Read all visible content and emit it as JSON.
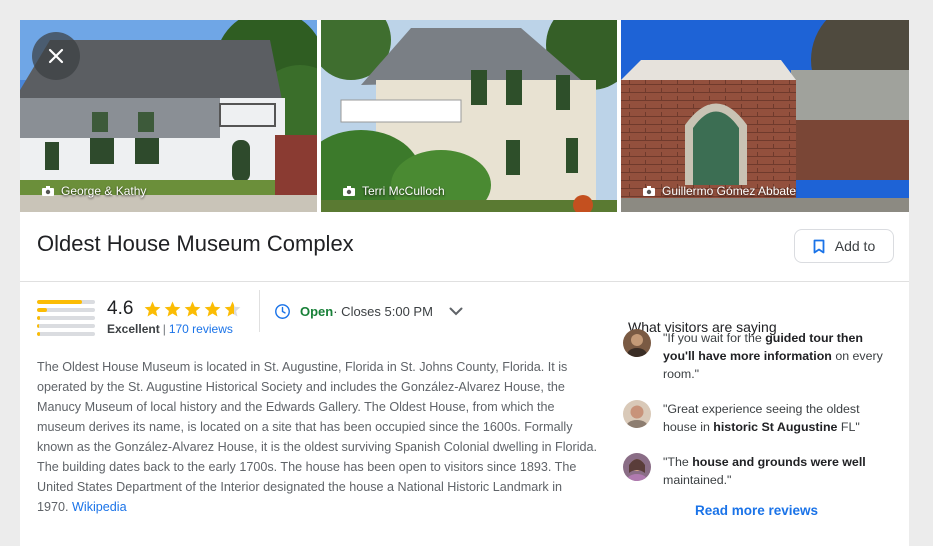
{
  "photos": [
    {
      "credit": "George & Kathy"
    },
    {
      "credit": "Terri McCulloch"
    },
    {
      "credit": "Guillermo Gómez Abbate"
    }
  ],
  "close_icon": "close-icon",
  "place": {
    "title": "Oldest House Museum Complex",
    "add_to_label": "Add to"
  },
  "rating": {
    "value": "4.6",
    "label": "Excellent",
    "separator": "|",
    "reviews_link": "170 reviews",
    "stars_filled": 4.6,
    "distribution": [
      0.78,
      0.18,
      0.06,
      0.03,
      0.06
    ]
  },
  "hours": {
    "status": "Open",
    "closes": " · Closes 5:00 PM"
  },
  "description": {
    "text": "The Oldest House Museum is located in St. Augustine, Florida in St. Johns County, Florida. It is operated by the St. Augustine Historical Society and includes the González-Alvarez House, the Manucy Museum of local history and the Edwards Gallery. The Oldest House, from which the museum derives its name, is located on a site that has been occupied since the 1600s. Formally known as the González-Alvarez House, it is the oldest surviving Spanish Colonial dwelling in Florida. The building dates back to the early 1700s. The house has been open to visitors since 1893. The United States Department of the Interior designated the house a National Historic Landmark in 1970.",
    "source_link": "Wikipedia"
  },
  "visitors": {
    "title": "What visitors are saying",
    "reviews": [
      {
        "pre": "\"If you wait for the ",
        "bold": "guided tour then you'll have more information",
        "post": " on every room.\""
      },
      {
        "pre": "\"Great experience seeing the oldest house in ",
        "bold": "historic St Augustine",
        "post": " FL\""
      },
      {
        "pre": "\"The ",
        "bold": "house and grounds were well",
        "post": " maintained.\""
      }
    ],
    "read_more": "Read more reviews"
  },
  "colors": {
    "accent": "#1a73e8",
    "star": "#fbbc04",
    "open": "#188038"
  }
}
